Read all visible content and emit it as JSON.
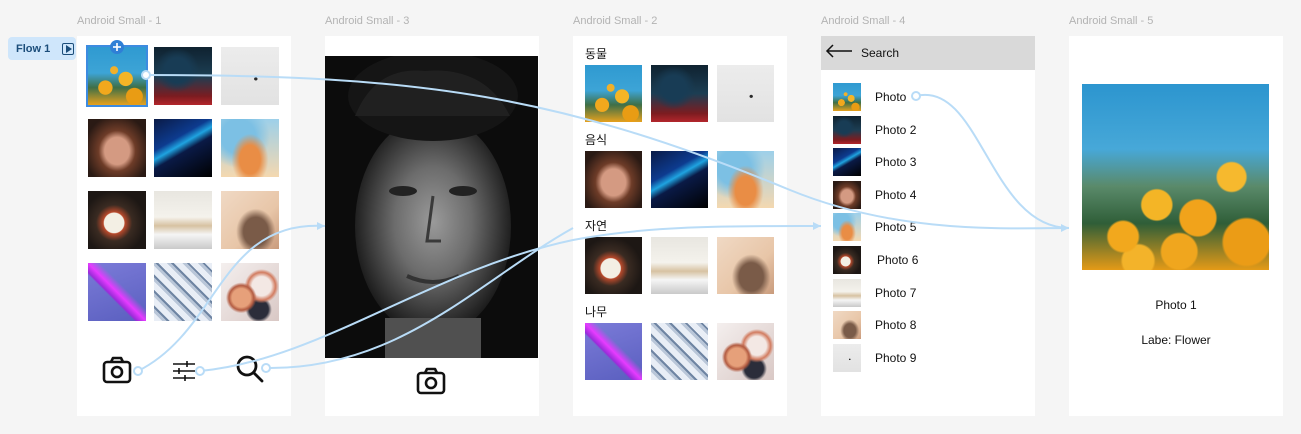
{
  "flow": {
    "label": "Flow 1"
  },
  "frames": [
    {
      "title": "Android Small - 1"
    },
    {
      "title": "Android Small - 3"
    },
    {
      "title": "Android Small - 2"
    },
    {
      "title": "Android Small - 4"
    },
    {
      "title": "Android Small - 5"
    }
  ],
  "grid_screen": {
    "photos": [
      "flower",
      "forest",
      "snow",
      "portrait-woman",
      "blue-gradient",
      "watercolor",
      "food-bowl",
      "meeting",
      "deer",
      "purple-abstract",
      "white-structure",
      "spheres"
    ],
    "bottom_icons": [
      "camera-icon",
      "filter-icon",
      "search-icon"
    ]
  },
  "camera_screen": {
    "photo": "portrait-man",
    "icon": "camera-icon"
  },
  "category_screen": {
    "sections": [
      {
        "title": "동물"
      },
      {
        "title": "음식"
      },
      {
        "title": "자연"
      },
      {
        "title": "나무"
      }
    ]
  },
  "search_screen": {
    "header": "Search",
    "items": [
      "Photo",
      "Photo 2",
      "Photo 3",
      "Photo 4",
      "Photo 5",
      "Photo 6",
      "Photo 7",
      "Photo 8",
      "Photo 9"
    ]
  },
  "detail_screen": {
    "title": "Photo 1",
    "label": "Labe: Flower"
  },
  "colors": {
    "flow_line": "#b9dcf7",
    "selection": "#3d8be0",
    "search_bar": "#d9d9d9"
  }
}
